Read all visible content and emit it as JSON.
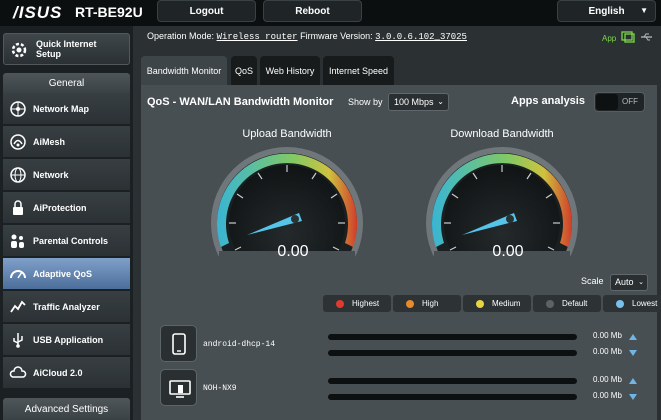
{
  "header": {
    "brand": "/ISUS",
    "model": "RT-BE92U",
    "logout_label": "Logout",
    "reboot_label": "Reboot",
    "language": "English"
  },
  "status": {
    "operation_mode_label": "Operation Mode:",
    "operation_mode": "Wireless router",
    "firmware_label": "Firmware Version:",
    "firmware": "3.0.0.6.102_37025",
    "app_label": "App"
  },
  "sidebar": {
    "quick_internet_setup": "Quick Internet Setup",
    "general_heading": "General",
    "items": [
      {
        "label": "Network Map",
        "icon": "network-map-icon"
      },
      {
        "label": "AiMesh",
        "icon": "aimesh-icon"
      },
      {
        "label": "Network",
        "icon": "globe-icon"
      },
      {
        "label": "AiProtection",
        "icon": "lock-icon"
      },
      {
        "label": "Parental Controls",
        "icon": "family-icon"
      },
      {
        "label": "Adaptive QoS",
        "icon": "speedometer-icon",
        "active": true
      },
      {
        "label": "Traffic Analyzer",
        "icon": "chart-icon"
      },
      {
        "label": "USB Application",
        "icon": "usb-icon"
      },
      {
        "label": "AiCloud 2.0",
        "icon": "cloud-icon"
      }
    ],
    "advanced_heading": "Advanced Settings"
  },
  "tabs": [
    {
      "label": "Bandwidth Monitor",
      "active": true
    },
    {
      "label": "QoS"
    },
    {
      "label": "Web History"
    },
    {
      "label": "Internet Speed"
    }
  ],
  "panel": {
    "title": "QoS - WAN/LAN Bandwidth Monitor",
    "show_by_label": "Show by",
    "show_by_value": "100 Mbps",
    "apps_analysis_label": "Apps analysis",
    "apps_analysis_state": "OFF",
    "upload_label": "Upload Bandwidth",
    "download_label": "Download Bandwidth",
    "upload_value": "0.00",
    "download_value": "0.00",
    "scale_label": "Scale",
    "scale_value": "Auto"
  },
  "legend": [
    {
      "label": "Highest",
      "color": "#e03a2f"
    },
    {
      "label": "High",
      "color": "#e8892a"
    },
    {
      "label": "Medium",
      "color": "#e8d442"
    },
    {
      "label": "Default",
      "color": "#5c6366"
    },
    {
      "label": "Lowest",
      "color": "#79c1ec"
    }
  ],
  "clients": [
    {
      "name": "android-dhcp-14",
      "icon": "phone-icon",
      "up": "0.00 Mb",
      "down": "0.00 Mb"
    },
    {
      "name": "NOH-NX9",
      "icon": "desktop-icon",
      "up": "0.00 Mb",
      "down": "0.00 Mb"
    }
  ],
  "colors": {
    "accent": "#4c6e9a",
    "gauge_ring": "#5ac8e6",
    "needle": "#56c3e8",
    "app_green": "#7ed64a"
  }
}
